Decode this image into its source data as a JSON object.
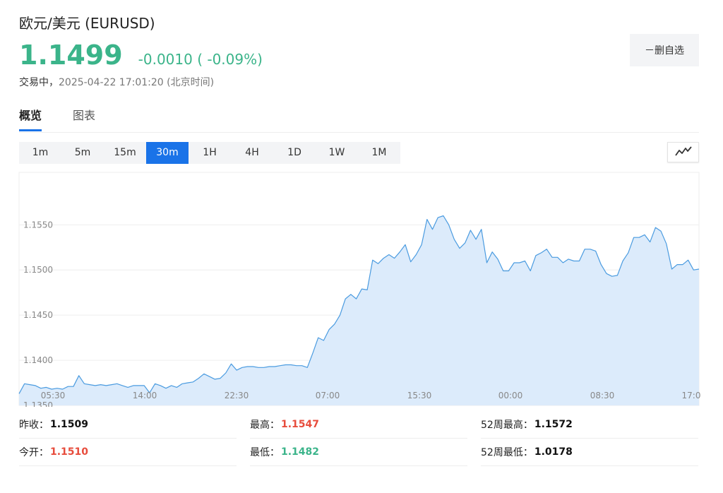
{
  "header": {
    "title": "欧元/美元  (EURUSD)",
    "price": "1.1499",
    "change": "-0.0010 ( -0.09%)",
    "status_label": "交易中，",
    "timestamp": "2025-04-22 17:01:20  (北京时间)",
    "remove_button": "－删自选"
  },
  "tabs": [
    {
      "label": "概览"
    },
    {
      "label": "图表"
    }
  ],
  "intervals": [
    {
      "label": "1m"
    },
    {
      "label": "5m"
    },
    {
      "label": "15m"
    },
    {
      "label": "30m"
    },
    {
      "label": "1H"
    },
    {
      "label": "4H"
    },
    {
      "label": "1D"
    },
    {
      "label": "1W"
    },
    {
      "label": "1M"
    }
  ],
  "active_interval": "30m",
  "chart_type_icon": "line-chart-icon",
  "colors": {
    "up": "#e74c3c",
    "down": "#3bb48a",
    "accent": "#1a73e8",
    "line": "#4a9be0",
    "fill": "#dcebfb"
  },
  "chart_data": {
    "type": "area",
    "ylim": [
      1.135,
      1.1605
    ],
    "yticks": [
      "1.1350",
      "1.1400",
      "1.1450",
      "1.1500",
      "1.1550"
    ],
    "xticks": [
      "05:30",
      "14:00",
      "22:30",
      "07:00",
      "15:30",
      "00:00",
      "08:30",
      "17:0"
    ],
    "grid": true,
    "values": [
      1.1363,
      1.1374,
      1.1373,
      1.1372,
      1.1369,
      1.137,
      1.1368,
      1.1369,
      1.1368,
      1.1371,
      1.1371,
      1.1383,
      1.1374,
      1.1373,
      1.1372,
      1.1373,
      1.1372,
      1.1373,
      1.1374,
      1.1372,
      1.137,
      1.1372,
      1.1372,
      1.1372,
      1.1364,
      1.1374,
      1.1372,
      1.1369,
      1.1372,
      1.137,
      1.1374,
      1.1375,
      1.1376,
      1.138,
      1.1385,
      1.1382,
      1.1379,
      1.138,
      1.1386,
      1.1396,
      1.1389,
      1.1392,
      1.1393,
      1.1393,
      1.1392,
      1.1392,
      1.1393,
      1.1393,
      1.1394,
      1.1395,
      1.1395,
      1.1394,
      1.1394,
      1.1392,
      1.1408,
      1.1425,
      1.1422,
      1.1434,
      1.144,
      1.145,
      1.1468,
      1.1473,
      1.1468,
      1.1479,
      1.1478,
      1.1511,
      1.1507,
      1.1513,
      1.1517,
      1.1513,
      1.152,
      1.1528,
      1.1509,
      1.1517,
      1.1528,
      1.1556,
      1.1545,
      1.1558,
      1.156,
      1.155,
      1.1534,
      1.1524,
      1.153,
      1.1544,
      1.1534,
      1.1545,
      1.1508,
      1.152,
      1.1512,
      1.1499,
      1.1499,
      1.1508,
      1.1508,
      1.151,
      1.1499,
      1.1516,
      1.1519,
      1.1523,
      1.1514,
      1.1514,
      1.1508,
      1.1512,
      1.151,
      1.151,
      1.1523,
      1.1523,
      1.1521,
      1.1506,
      1.1496,
      1.1493,
      1.1494,
      1.151,
      1.1519,
      1.1536,
      1.1536,
      1.1539,
      1.1531,
      1.1547,
      1.1543,
      1.1529,
      1.1501,
      1.1506,
      1.1506,
      1.1511,
      1.15,
      1.1501
    ]
  },
  "stats": [
    [
      {
        "label": "昨收：",
        "value": "1.1509",
        "tone": "dark"
      },
      {
        "label": "最高：",
        "value": "1.1547",
        "tone": "red"
      },
      {
        "label": "52周最高：",
        "value": "1.1572",
        "tone": "dark"
      }
    ],
    [
      {
        "label": "今开：",
        "value": "1.1510",
        "tone": "red"
      },
      {
        "label": "最低：",
        "value": "1.1482",
        "tone": "green"
      },
      {
        "label": "52周最低：",
        "value": "1.0178",
        "tone": "dark"
      }
    ]
  ]
}
